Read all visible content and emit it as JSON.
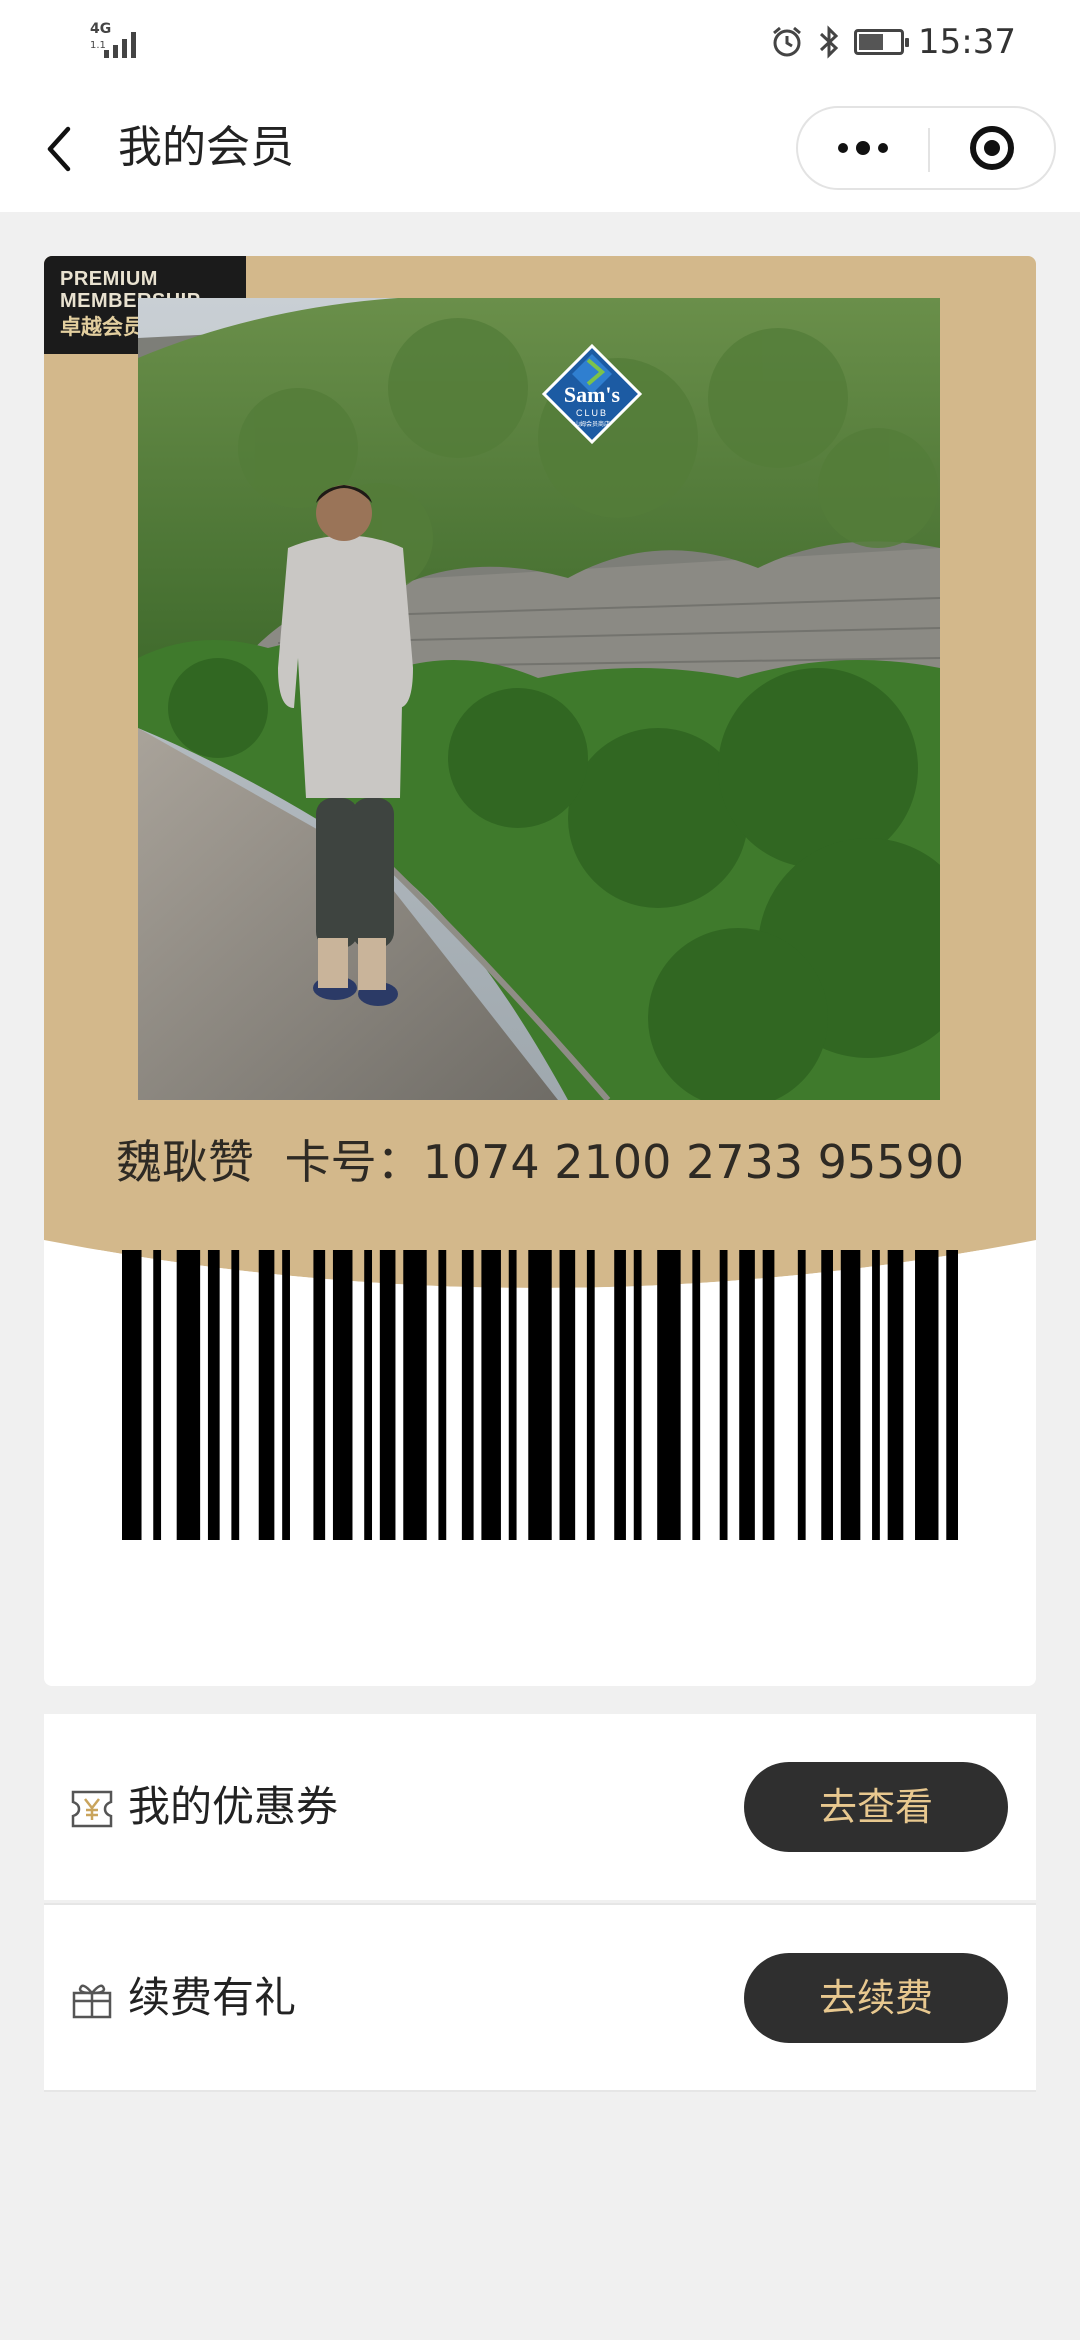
{
  "status_bar": {
    "network": "4G",
    "network_sub": "1.1",
    "time": "15:37",
    "icons": [
      "alarm-icon",
      "bluetooth-icon",
      "battery-icon"
    ]
  },
  "nav": {
    "title": "我的会员",
    "icons": [
      "back-arrow-icon",
      "more-dots-icon",
      "target-icon"
    ]
  },
  "card": {
    "badge": {
      "line1": "PREMIUM",
      "line2": "MEMBERSHIP",
      "line3": "卓越会员"
    },
    "logo": {
      "brand": "Sam's",
      "sub": "CLUB",
      "cn": "山姆会员商店"
    },
    "member_name": "魏耿赞",
    "card_label": "卡号：",
    "card_number": "1074 2100 2733 95590",
    "colors": {
      "gold": "#d3b88b",
      "badge_bg": "#1b1b1b"
    }
  },
  "rows": [
    {
      "icon": "coupon-icon",
      "label": "我的优惠券",
      "button": "去查看"
    },
    {
      "icon": "gift-icon",
      "label": "续费有礼",
      "button": "去续费"
    }
  ],
  "colors": {
    "button_bg": "#2f2f2f",
    "button_text": "#e8c88f",
    "page_bg": "#f0f0f0"
  }
}
